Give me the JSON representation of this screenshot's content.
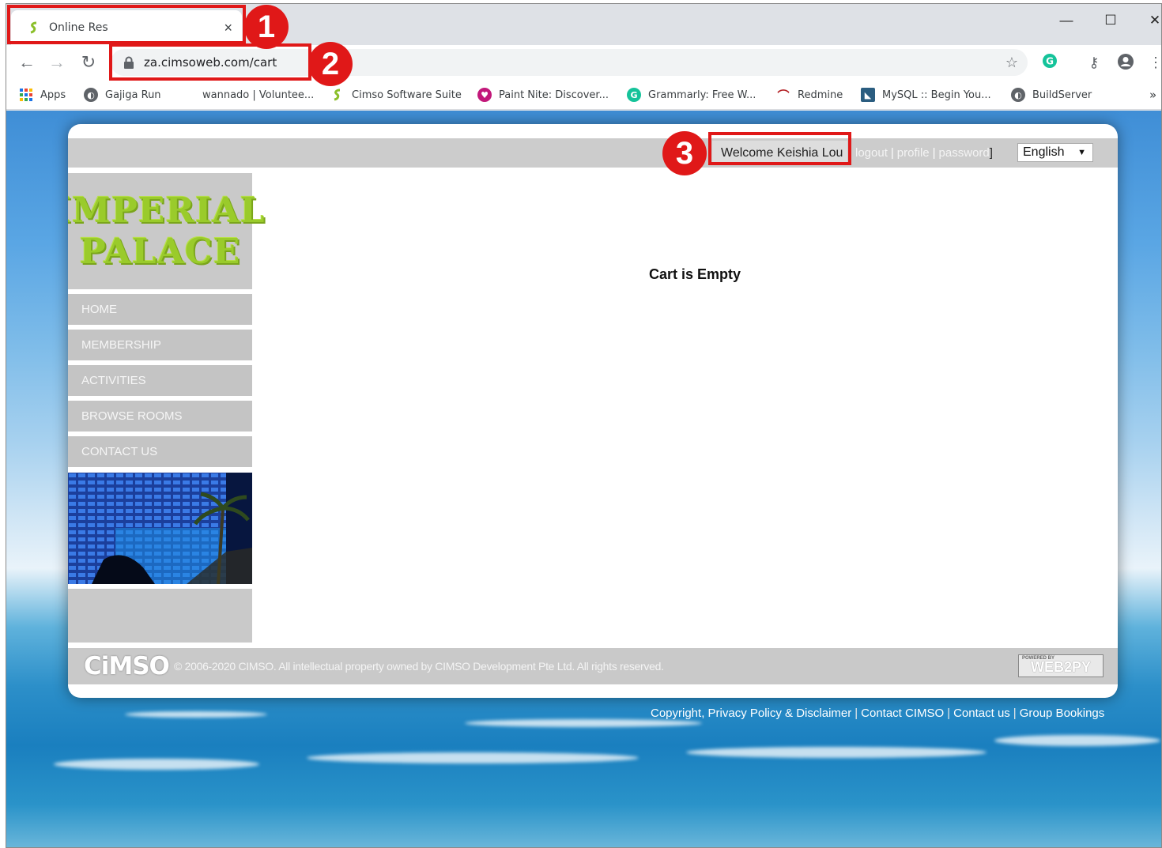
{
  "tab": {
    "title": "Online Res",
    "close": "×"
  },
  "address": {
    "url": "za.cimsoweb.com/cart"
  },
  "bookmarks": [
    {
      "label": "Apps",
      "icon": "apps-grid-icon"
    },
    {
      "label": "Gajiga Run",
      "icon": "globe-icon"
    },
    {
      "label": "wannado | Voluntee...",
      "icon": ""
    },
    {
      "label": "Cimso Software Suite",
      "icon": "cimso-icon"
    },
    {
      "label": "Paint Nite: Discover...",
      "icon": "paint-nite-icon"
    },
    {
      "label": "Grammarly: Free W...",
      "icon": "grammarly-icon"
    },
    {
      "label": "Redmine",
      "icon": "redmine-icon"
    },
    {
      "label": "MySQL :: Begin You...",
      "icon": "mysql-icon"
    },
    {
      "label": "BuildServer",
      "icon": "globe-icon"
    }
  ],
  "bookmarks_more": "»",
  "userbar": {
    "welcome": "Welcome Keishia Lou",
    "logout": "logout",
    "profile": "profile",
    "password": "password",
    "sep": "|",
    "close_bracket": "]",
    "language": "English"
  },
  "logo": {
    "line1": "IMPERIAL",
    "line2": "PALACE"
  },
  "menu": [
    {
      "label": "HOME"
    },
    {
      "label": "MEMBERSHIP"
    },
    {
      "label": "ACTIVITIES"
    },
    {
      "label": "BROWSE ROOMS"
    },
    {
      "label": "CONTACT US"
    }
  ],
  "main": {
    "message": "Cart is Empty"
  },
  "footer": {
    "logo_text": "CiMSO",
    "copyright": "© 2006-2020 CIMSO. All intellectual property owned by CIMSO Development Pte Ltd. All rights reserved.",
    "badge_small": "POWERED BY",
    "badge": "WEB2PY"
  },
  "bottom_links": [
    {
      "label": "Copyright, Privacy Policy & Disclaimer"
    },
    {
      "label": "Contact CIMSO"
    },
    {
      "label": "Contact us"
    },
    {
      "label": "Group Bookings"
    }
  ],
  "callouts": [
    {
      "label": "1"
    },
    {
      "label": "2"
    },
    {
      "label": "3"
    }
  ],
  "colors": {
    "callout": "#e01818",
    "logo_green": "#9acb2b",
    "menu_bg": "#c4c4c4"
  }
}
